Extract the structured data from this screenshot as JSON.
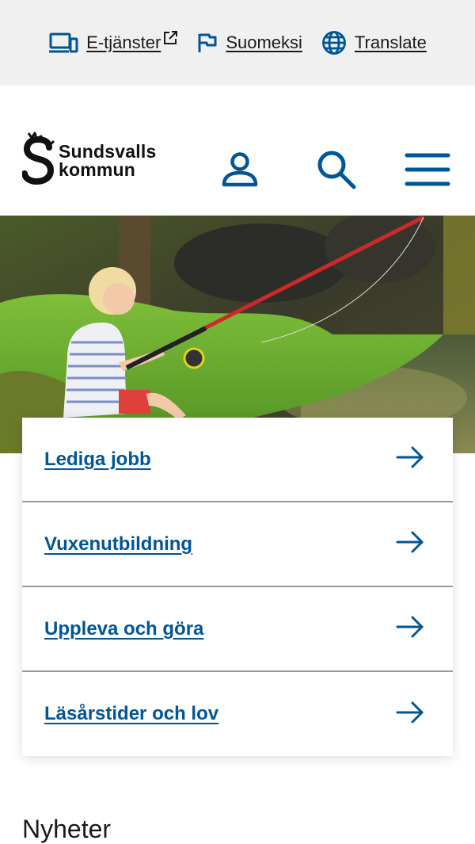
{
  "utility": {
    "eservices_label": "E-tjänster",
    "language_label": "Suomeksi",
    "translate_label": "Translate"
  },
  "header": {
    "logo_line1": "Sundsvalls",
    "logo_line2": "kommun"
  },
  "quick_links": [
    {
      "label": "Lediga jobb"
    },
    {
      "label": "Vuxenutbildning"
    },
    {
      "label": "Uppleva och göra"
    },
    {
      "label": "Läsårstider och lov"
    }
  ],
  "news": {
    "heading": "Nyheter"
  },
  "colors": {
    "brand_blue": "#005595",
    "utility_bar_bg": "#f0f0f0",
    "divider": "#9a9a9a"
  },
  "icons": {
    "eservices": "devices-icon",
    "external": "external-link-icon",
    "language": "flag-icon",
    "translate": "globe-icon",
    "account": "user-icon",
    "search": "search-icon",
    "menu": "hamburger-menu-icon",
    "link_arrow": "arrow-right-icon"
  }
}
